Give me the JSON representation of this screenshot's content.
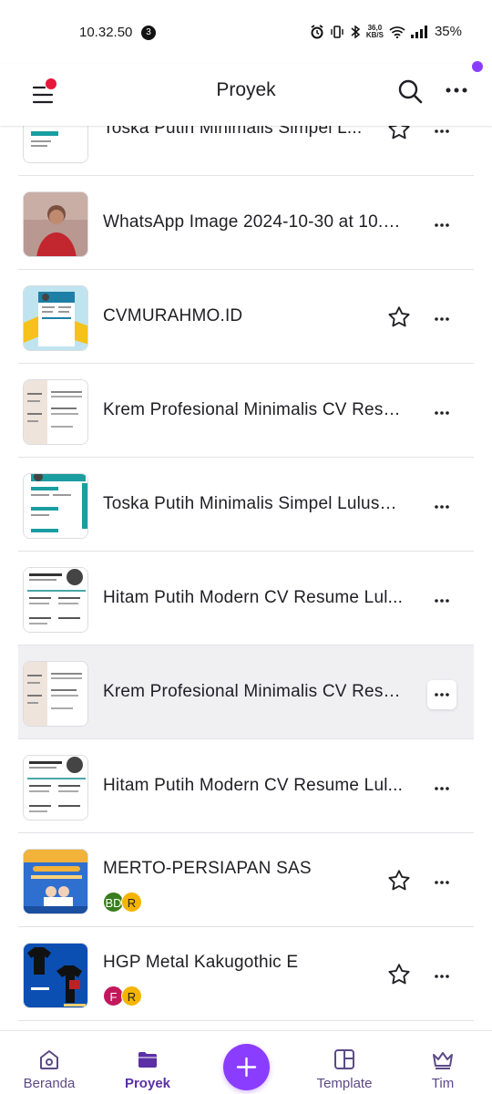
{
  "status_bar": {
    "time": "10.32.50",
    "notification_count": "3",
    "network_speed_value": "36,0",
    "network_speed_unit": "KB/S",
    "battery": "35%"
  },
  "header": {
    "title": "Proyek"
  },
  "projects": [
    {
      "title": "Toska Putih Minimalis Simpel L...",
      "starred": false,
      "has_star": true
    },
    {
      "title": "WhatsApp Image 2024-10-30 at 10.5...",
      "has_star": false
    },
    {
      "title": "CVMURAHMO.ID",
      "has_star": true
    },
    {
      "title": "Krem Profesional Minimalis CV Resu...",
      "has_star": false
    },
    {
      "title": "Toska Putih Minimalis Simpel Lulusa...",
      "has_star": false
    },
    {
      "title": "Hitam Putih Modern CV Resume Lul...",
      "has_star": false
    },
    {
      "title": "Krem Profesional Minimalis CV Resu...",
      "has_star": false,
      "highlighted": true
    },
    {
      "title": "Hitam Putih Modern CV Resume Lul...",
      "has_star": false
    },
    {
      "title": "MERTO-PERSIAPAN SAS",
      "has_star": true,
      "avatars": [
        "BD",
        "R"
      ]
    },
    {
      "title": "HGP Metal Kakugothic E",
      "has_star": true,
      "avatars": [
        "F",
        "R"
      ]
    }
  ],
  "avatar_colors": {
    "BD": "#3a7d1e",
    "R": "#f4b400",
    "F": "#c2185b"
  },
  "bottom_nav": {
    "home_label": "Beranda",
    "projects_label": "Proyek",
    "create_label": "+",
    "template_label": "Template",
    "team_label": "Tim"
  },
  "colors": {
    "accent": "#8b3dff",
    "notification_dot": "#e6173b"
  }
}
